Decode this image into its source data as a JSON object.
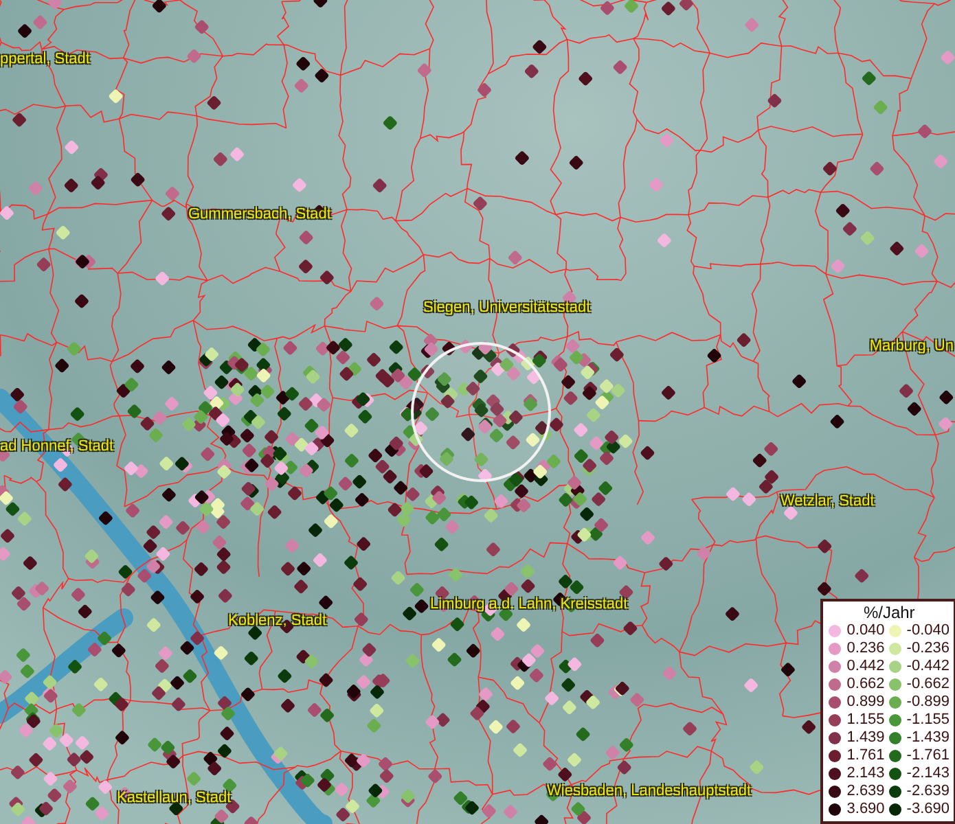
{
  "map": {
    "place_labels": [
      {
        "text": "ppertal, Stadt"
      },
      {
        "text": "Gummersbach, Stadt"
      },
      {
        "text": "Siegen, Universitätsstadt"
      },
      {
        "text": "Marburg, Un"
      },
      {
        "text": "ad Honnef, Stadt"
      },
      {
        "text": "Wetzlar, Stadt"
      },
      {
        "text": "Limburg a.d. Lahn, Kreisstadt"
      },
      {
        "text": "Koblenz, Stadt"
      },
      {
        "text": "Kastellaun, Stadt"
      },
      {
        "text": "Wiesbaden, Landeshauptstadt"
      }
    ]
  },
  "legend": {
    "title": "%/Jahr",
    "positive": [
      {
        "value": "0.040",
        "color": "#f4b8e0"
      },
      {
        "value": "0.236",
        "color": "#e49ac4"
      },
      {
        "value": "0.442",
        "color": "#d081a8"
      },
      {
        "value": "0.662",
        "color": "#c06a8c"
      },
      {
        "value": "0.899",
        "color": "#a94e6e"
      },
      {
        "value": "1.155",
        "color": "#963e58"
      },
      {
        "value": "1.439",
        "color": "#82304a"
      },
      {
        "value": "1.761",
        "color": "#6a1e30"
      },
      {
        "value": "2.143",
        "color": "#4e0f1e"
      },
      {
        "value": "2.639",
        "color": "#3a0812"
      },
      {
        "value": "3.690",
        "color": "#20040a"
      }
    ],
    "negative": [
      {
        "value": "-0.040",
        "color": "#eef5b4"
      },
      {
        "value": "-0.236",
        "color": "#cfe8a0"
      },
      {
        "value": "-0.442",
        "color": "#a8d384"
      },
      {
        "value": "-0.662",
        "color": "#88c26a"
      },
      {
        "value": "-0.899",
        "color": "#6aae50"
      },
      {
        "value": "-1.155",
        "color": "#4a963a"
      },
      {
        "value": "-1.439",
        "color": "#34802a"
      },
      {
        "value": "-1.761",
        "color": "#246a1c"
      },
      {
        "value": "-2.143",
        "color": "#145212"
      },
      {
        "value": "-2.639",
        "color": "#0c3c0c"
      },
      {
        "value": "-3.690",
        "color": "#062806"
      }
    ]
  }
}
